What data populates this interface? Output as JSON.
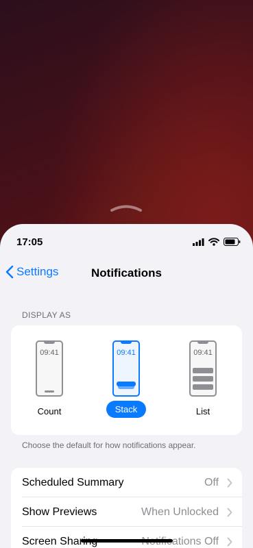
{
  "status_bar": {
    "time": "17:05"
  },
  "nav": {
    "back_label": "Settings",
    "title": "Notifications"
  },
  "display_as": {
    "header": "DISPLAY AS",
    "options": [
      {
        "label": "Count",
        "clock": "09:41",
        "selected": false
      },
      {
        "label": "Stack",
        "clock": "09:41",
        "selected": true
      },
      {
        "label": "List",
        "clock": "09:41",
        "selected": false
      }
    ],
    "footer": "Choose the default for how notifications appear."
  },
  "settings_rows": [
    {
      "label": "Scheduled Summary",
      "value": "Off"
    },
    {
      "label": "Show Previews",
      "value": "When Unlocked"
    },
    {
      "label": "Screen Sharing",
      "value": "Notifications Off"
    }
  ],
  "colors": {
    "accent": "#0a7aff",
    "background": "#f2f2f7",
    "secondary_text": "#8e8e93"
  }
}
